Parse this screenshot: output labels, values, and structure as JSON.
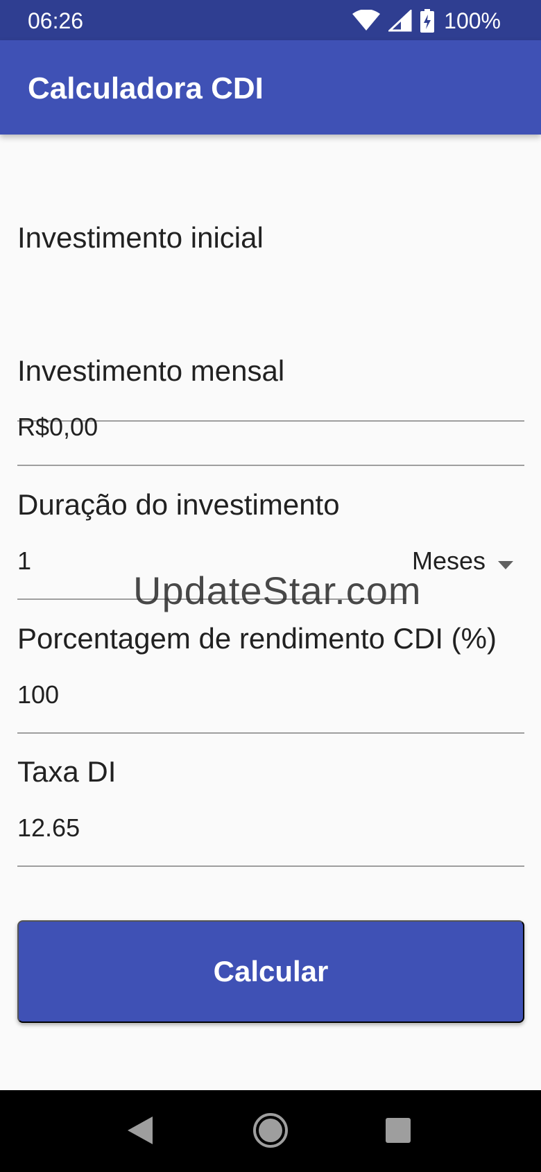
{
  "status_bar": {
    "time": "06:26",
    "battery": "100%",
    "icons": [
      "wifi-icon",
      "signal-icon",
      "battery-charging-icon"
    ]
  },
  "app_bar": {
    "title": "Calculadora CDI"
  },
  "fields": {
    "initial": {
      "label": "Investimento inicial",
      "value": ""
    },
    "monthly": {
      "label": "Investimento mensal",
      "value": "R$0,00"
    },
    "duration": {
      "label": "Duração do investimento",
      "value": "1",
      "unit": "Meses"
    },
    "cdi_percent": {
      "label": "Porcentagem de rendimento CDI (%)",
      "value": "100"
    },
    "di_rate": {
      "label": "Taxa DI",
      "value": "12.65"
    }
  },
  "watermark": "UpdateStar.com",
  "button": {
    "label": "Calcular"
  },
  "nav": [
    "back-icon",
    "home-icon",
    "recents-icon"
  ],
  "colors": {
    "status_bar": "#2f3e91",
    "primary": "#3f51b5",
    "background": "#fafafa"
  }
}
